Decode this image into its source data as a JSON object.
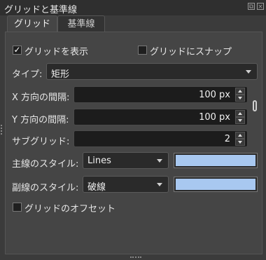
{
  "window": {
    "title": "グリッドと基準線",
    "float_icon": "float-icon",
    "close_icon": "close-icon"
  },
  "tabs": [
    {
      "label": "グリッド",
      "active": true
    },
    {
      "label": "基準線",
      "active": false
    }
  ],
  "grid": {
    "show_grid": {
      "label": "グリッドを表示",
      "checked": true
    },
    "snap_grid": {
      "label": "グリッドにスナップ",
      "checked": false
    },
    "type": {
      "label": "タイプ:",
      "value": "矩形"
    },
    "x_spacing": {
      "label": "X 方向の間隔:",
      "value": "100 px"
    },
    "y_spacing": {
      "label": "Y 方向の間隔:",
      "value": "100 px"
    },
    "subgrid": {
      "label": "サブグリッド:",
      "value": "2"
    },
    "major_style": {
      "label": "主線のスタイル:",
      "value": "Lines",
      "color": "#a8c8f0"
    },
    "minor_style": {
      "label": "副線のスタイル:",
      "value": "破線",
      "color": "#a8c8f0"
    },
    "grid_offset": {
      "label": "グリッドのオフセット",
      "checked": false
    }
  },
  "colors": {
    "background": "#3b3b3b",
    "panel": "#454545",
    "field": "#1c1c1c",
    "swatch": "#a8c8f0"
  }
}
